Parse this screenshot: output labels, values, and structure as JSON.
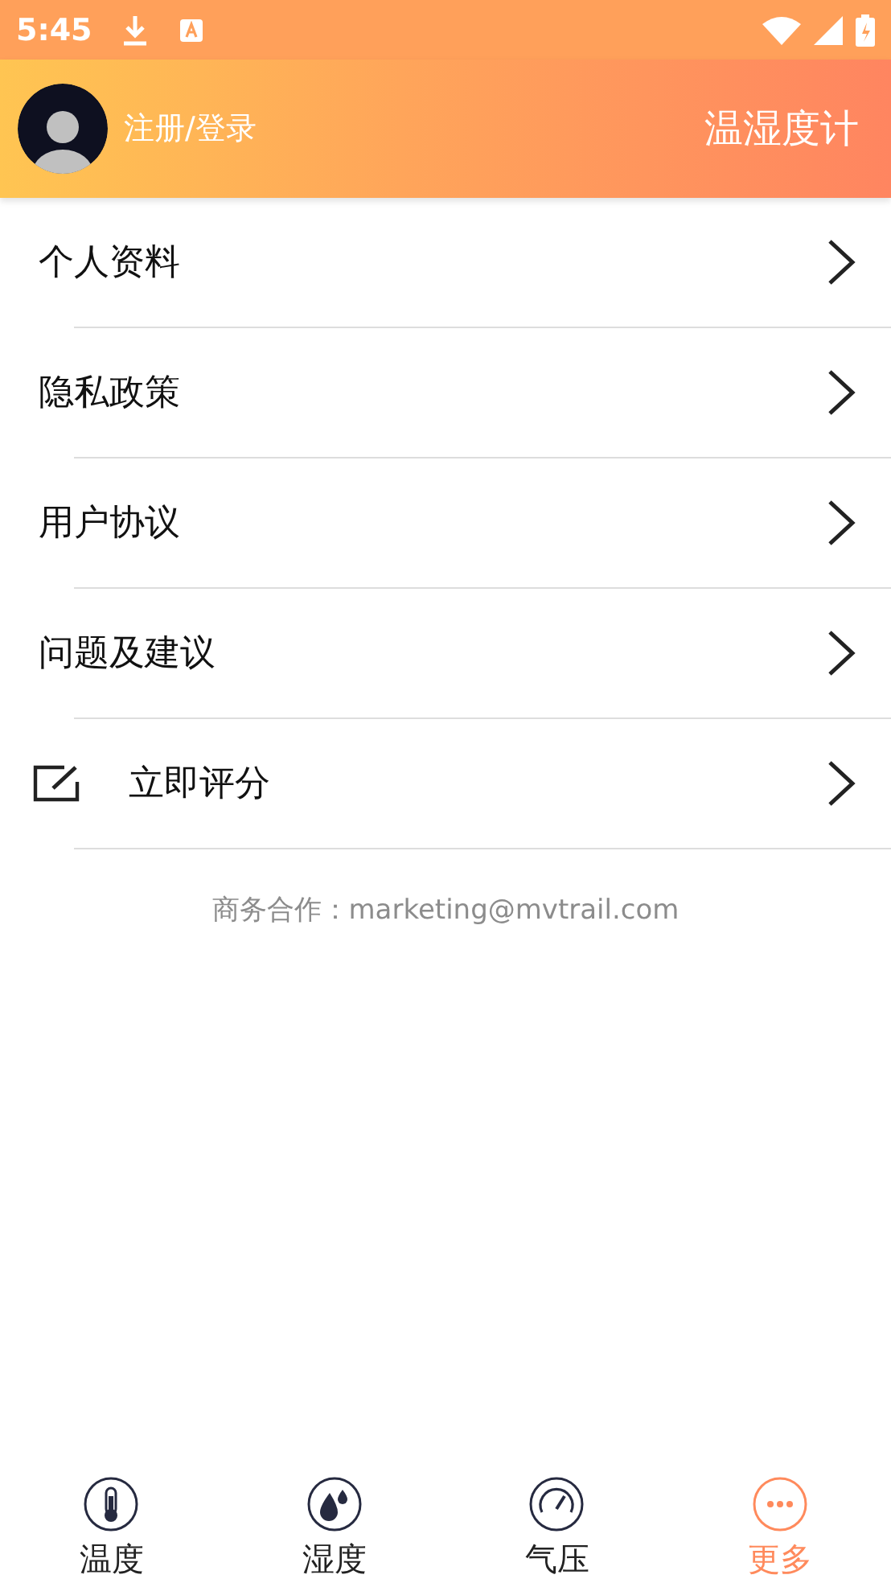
{
  "status_bar": {
    "time": "5:45"
  },
  "header": {
    "login": "注册/登录",
    "title": "温湿度计"
  },
  "menu": [
    {
      "kind": "plain",
      "label": "个人资料"
    },
    {
      "kind": "plain",
      "label": "隐私政策"
    },
    {
      "kind": "plain",
      "label": "用户协议"
    },
    {
      "kind": "plain",
      "label": "问题及建议"
    },
    {
      "kind": "edit",
      "label": "立即评分"
    }
  ],
  "footer": "商务合作：marketing@mvtrail.com",
  "bottom_nav": [
    {
      "kind": "temperature",
      "label": "温度",
      "selected": false
    },
    {
      "kind": "humidity",
      "label": "湿度",
      "selected": false
    },
    {
      "kind": "pressure",
      "label": "气压",
      "selected": false
    },
    {
      "kind": "more",
      "label": "更多",
      "selected": true
    }
  ]
}
